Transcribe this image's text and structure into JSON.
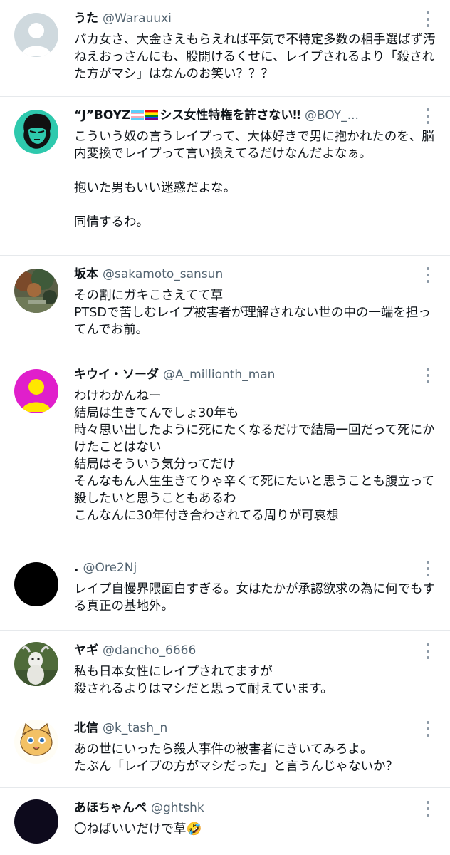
{
  "tweets": [
    {
      "name": "うた",
      "handle": "@Warauuxi",
      "text": "バカ女さ、大金さえもらえれば平気で不特定多数の相手選ばず汚ねえおっさんにも、股開けるくせに、レイプされるより「殺された方がマシ」はなんのお笑い？？？",
      "avatar": "default-profile-gray"
    },
    {
      "name_prefix": "“J”BOYZ",
      "name_suffix": "シス女性特権を許さない‼",
      "flags": [
        "transgender-flag",
        "rainbow-flag"
      ],
      "handle": "@BOY_...",
      "text": "こういう奴の言うレイプって、大体好きで男に抱かれたのを、脳内変換でレイプって言い換えてるだけなんだよなぁ。\n\n抱いた男もいい迷惑だよな。\n\n同情するわ。",
      "avatar": "face-illustration-teal"
    },
    {
      "name": "坂本",
      "handle": "@sakamoto_sansun",
      "text": "その割にガキこさえてて草\nPTSDで苦しむレイプ被害者が理解されない世の中の一端を担ってんでお前。",
      "avatar": "autumn-garden-photo"
    },
    {
      "name": "キウイ・ソーダ",
      "handle": "@A_millionth_man",
      "text": "わけわかんねー\n結局は生きてんでしょ30年も\n時々思い出したように死にたくなるだけで結局一回だって死にかけたことはない\n結局はそういう気分ってだけ\nそんなもん人生生きてりゃ辛くて死にたいと思うことも腹立って殺したいと思うこともあるわ\nこんなんに30年付き合わされてる周りが可哀想",
      "avatar": "default-profile-magenta"
    },
    {
      "name": ".",
      "handle": "@Ore2Nj",
      "text": "レイプ自慢界隈面白すぎる。女はたかが承認欲求の為に何でもする真正の基地外。",
      "avatar": "black-circle"
    },
    {
      "name": "ヤギ",
      "handle": "@dancho_6666",
      "text": "私も日本女性にレイプされてますが\n殺されるよりはマシだと思って耐えています。",
      "avatar": "goat-photo"
    },
    {
      "name": "北信",
      "handle": "@k_tash_n",
      "text": "あの世にいったら殺人事件の被害者にきいてみろよ。\nたぶん「レイプの方がマシだった」と言うんじゃないか？",
      "avatar": "cat-illustration"
    },
    {
      "name": "あほちゃんぺ",
      "handle": "@ghtshk",
      "text": "〇ねばいいだけで草🤣",
      "avatar": "dark-navy-circle"
    }
  ],
  "more_icon": "more-dots-vertical-icon",
  "colors": {
    "text": "#0f1419",
    "handle": "#536471",
    "divider": "#e6e9ec",
    "more": "#8b98a5"
  }
}
